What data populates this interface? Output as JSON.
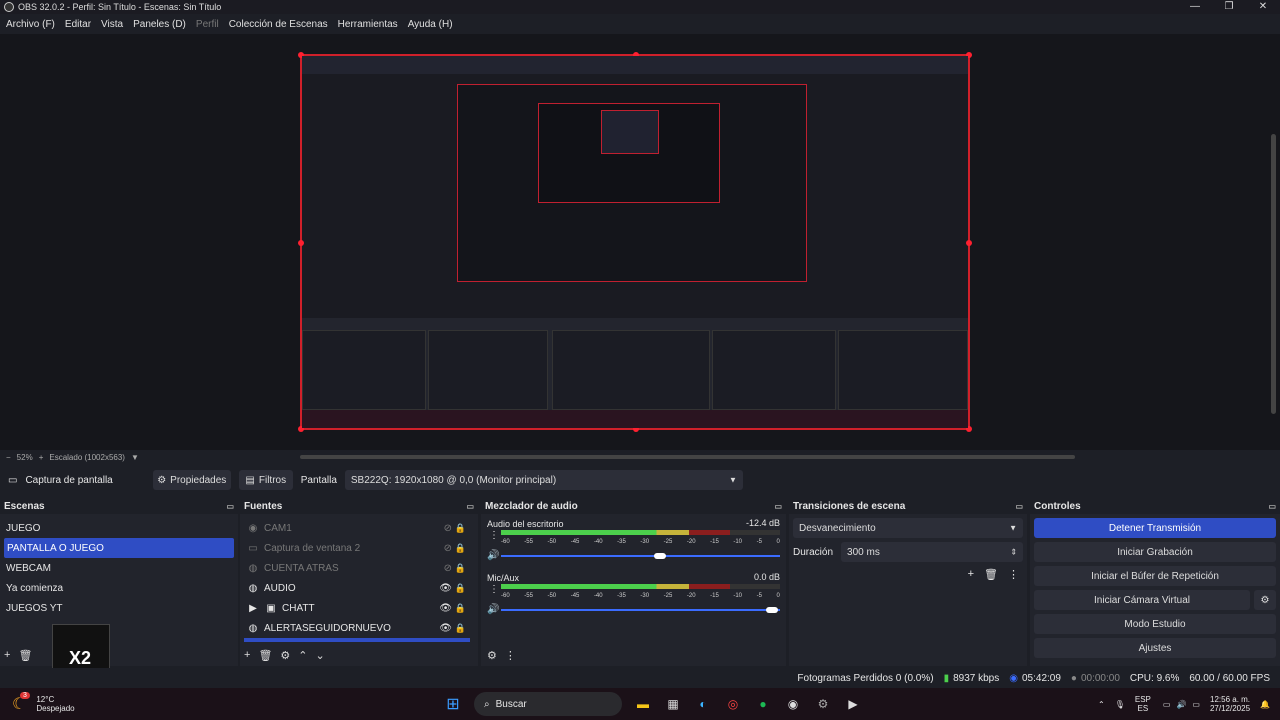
{
  "window": {
    "title": "OBS 32.0.2 - Perfil: Sin Título - Escenas: Sin Título",
    "controls": [
      "—",
      "❐",
      "✕"
    ]
  },
  "menu": [
    "Archivo (F)",
    "Editar",
    "Vista",
    "Paneles (D)",
    "Perfil",
    "Colección de Escenas",
    "Herramientas",
    "Ayuda (H)"
  ],
  "zoom": {
    "minus": "−",
    "value": "52%",
    "plus": "+",
    "scaled": "Escalado (1002x563)"
  },
  "source_bar": {
    "source_name": "Captura de pantalla",
    "properties": "Propiedades",
    "filters": "Filtros",
    "display_label": "Pantalla",
    "display_value": "SB222Q: 1920x1080 @ 0,0 (Monitor principal)"
  },
  "scenes": {
    "title": "Escenas",
    "items": [
      "JUEGO",
      "PANTALLA O JUEGO",
      "WEBCAM",
      "Ya comienza",
      "JUEGOS YT"
    ],
    "selected_index": 1
  },
  "sources": {
    "title": "Fuentes",
    "items": [
      {
        "name": "CAM1",
        "icon": "camera-icon",
        "visible": false
      },
      {
        "name": "Captura de ventana 2",
        "icon": "window-icon",
        "visible": false
      },
      {
        "name": "CUENTA ATRAS",
        "icon": "globe-icon",
        "visible": false
      },
      {
        "name": "AUDIO",
        "icon": "globe-icon",
        "visible": true
      },
      {
        "name": "CHATT",
        "icon": "folder-icon",
        "visible": true
      },
      {
        "name": "ALERTASEGUIDORNUEVO",
        "icon": "globe-icon",
        "visible": true
      }
    ]
  },
  "mixer": {
    "title": "Mezclador de audio",
    "channels": [
      {
        "name": "Audio del escritorio",
        "db": "-12.4 dB",
        "level": 0.82,
        "volume": 0.55
      },
      {
        "name": "Mic/Aux",
        "db": "0.0 dB",
        "level": 0.82,
        "volume": 0.97
      }
    ],
    "ticks": [
      "-60",
      "-55",
      "-50",
      "-45",
      "-40",
      "-35",
      "-30",
      "-25",
      "-20",
      "-15",
      "-10",
      "-5",
      "0"
    ]
  },
  "transitions": {
    "title": "Transiciones de escena",
    "selected": "Desvanecimiento",
    "duration_label": "Duración",
    "duration_value": "300 ms"
  },
  "controls": {
    "title": "Controles",
    "buttons": [
      "Detener Transmisión",
      "Iniciar Grabación",
      "Iniciar el Búfer de Repetición",
      "Iniciar Cámara Virtual",
      "Modo Estudio",
      "Ajustes"
    ]
  },
  "status": {
    "dropped": "Fotogramas Perdidos 0 (0.0%)",
    "bitrate": "8937 kbps",
    "stream_time": "05:42:09",
    "rec_time": "00:00:00",
    "cpu": "CPU: 9.6%",
    "fps": "60.00 / 60.00 FPS"
  },
  "taskbar": {
    "weather_temp": "12°C",
    "weather_desc": "Despejado",
    "weather_badge": "3",
    "search": "Buscar",
    "lang1": "ESP",
    "lang2": "ES",
    "time": "12:56 a. m.",
    "date": "27/12/2025"
  },
  "overlay_label": "X2",
  "colors": {
    "accent": "#2f4dc4",
    "selection_border": "#d0202a",
    "meter_green": "#4ccf4c",
    "meter_yellow": "#c5b33a",
    "meter_red": "#8b1e1e"
  }
}
